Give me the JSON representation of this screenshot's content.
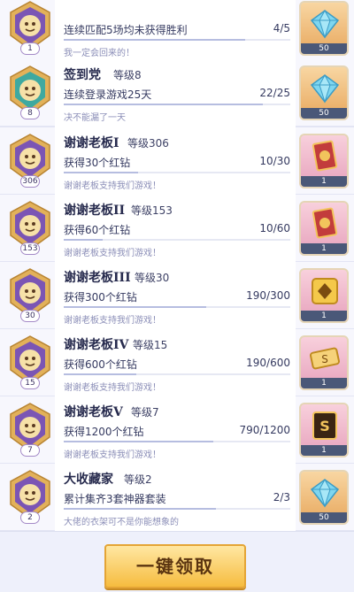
{
  "achievements": [
    {
      "title": "",
      "level": "",
      "desc": "连续匹配5场均未获得胜利",
      "progress": "4/5",
      "progress_ratio": 0.8,
      "hint": "我一定会回来的！",
      "badge_level": "1",
      "reward_type": "diamond",
      "reward_count": "50",
      "icon": "shield-medal-icon"
    },
    {
      "title": "签到党",
      "level": "等级8",
      "desc": "连续登录游戏25天",
      "progress": "22/25",
      "progress_ratio": 0.88,
      "hint": "决不能漏了一天",
      "badge_level": "8",
      "reward_type": "diamond",
      "reward_count": "50",
      "icon": "calendar-medal-icon"
    },
    {
      "title": "谢谢老板I",
      "level": "等级306",
      "desc": "获得30个红钻",
      "progress": "10/30",
      "progress_ratio": 0.33,
      "hint": "谢谢老板支持我们游戏！",
      "badge_level": "306",
      "reward_type": "card",
      "reward_count": "1",
      "icon": "boss-medal-icon"
    },
    {
      "title": "谢谢老板II",
      "level": "等级153",
      "desc": "获得60个红钻",
      "progress": "10/60",
      "progress_ratio": 0.17,
      "hint": "谢谢老板支持我们游戏！",
      "badge_level": "153",
      "reward_type": "card",
      "reward_count": "1",
      "icon": "boss-medal-icon"
    },
    {
      "title": "谢谢老板III",
      "level": "等级30",
      "desc": "获得300个红钻",
      "progress": "190/300",
      "progress_ratio": 0.63,
      "hint": "谢谢老板支持我们游戏！",
      "badge_level": "30",
      "reward_type": "frame",
      "reward_count": "1",
      "icon": "boss-medal-icon"
    },
    {
      "title": "谢谢老板IV",
      "level": "等级15",
      "desc": "获得600个红钻",
      "progress": "190/600",
      "progress_ratio": 0.32,
      "hint": "谢谢老板支持我们游戏！",
      "badge_level": "15",
      "reward_type": "ticket",
      "reward_count": "1",
      "icon": "boss-medal-icon"
    },
    {
      "title": "谢谢老板V",
      "level": "等级7",
      "desc": "获得1200个红钻",
      "progress": "790/1200",
      "progress_ratio": 0.66,
      "hint": "谢谢老板支持我们游戏！",
      "badge_level": "7",
      "reward_type": "s-card",
      "reward_count": "1",
      "icon": "boss-medal-icon"
    },
    {
      "title": "大收藏家",
      "level": "等级2",
      "desc": "累计集齐3套神器套装",
      "progress": "2/3",
      "progress_ratio": 0.67,
      "hint": "大佬的衣架可不是你能想象的",
      "badge_level": "2",
      "reward_type": "diamond",
      "reward_count": "50",
      "icon": "collector-medal-icon"
    }
  ],
  "footer": {
    "claim_all_label": "一键领取"
  },
  "colors": {
    "accent": "#f6bc3f",
    "purple": "#7b55b4",
    "gold": "#d9a441"
  }
}
